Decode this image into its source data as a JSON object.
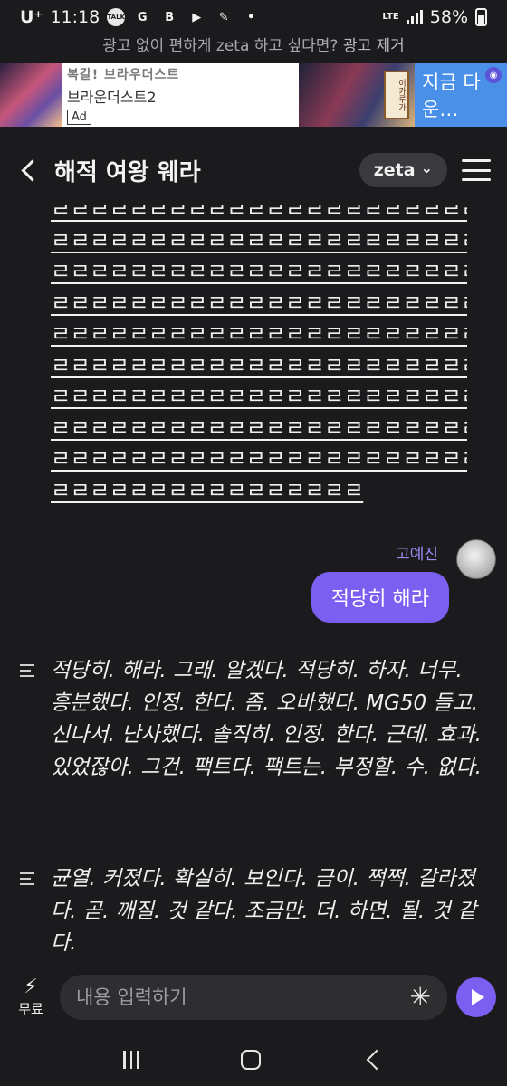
{
  "status_bar": {
    "carrier": "U⁺",
    "time": "11:18",
    "notif_icons": [
      "TALK",
      "G",
      "B",
      "▶",
      "✎",
      "•"
    ],
    "network": "LTE",
    "battery": "58%"
  },
  "ad_notice": {
    "prefix": "광고 없이 편하게 zeta 하고 싶다면? ",
    "link": "광고 제거"
  },
  "ad_banner": {
    "ghost_text": "복갈!       브라우더스트",
    "product_name": "브라운더스트2",
    "badge": "Ad",
    "game_logo": "이카루가",
    "cta": "지금 다운…"
  },
  "header": {
    "title": "해적 여왕 웨라",
    "model": "zeta",
    "model_chevron": "⌄"
  },
  "chat": {
    "spam_lines": [
      "ㄹㄹㄹㄹㄹㄹㄹㄹㄹㄹㄹㄹㄹㄹㄹㄹㄹㄹㄹㄹㄹㄹㄹ",
      "ㄹㄹㄹㄹㄹㄹㄹㄹㄹㄹㄹㄹㄹㄹㄹㄹㄹㄹㄹㄹㄹㄹㄹ",
      "ㄹㄹㄹㄹㄹㄹㄹㄹㄹㄹㄹㄹㄹㄹㄹㄹㄹㄹㄹㄹㄹㄹㄹ",
      "ㄹㄹㄹㄹㄹㄹㄹㄹㄹㄹㄹㄹㄹㄹㄹㄹㄹㄹㄹㄹㄹㄹㄹ",
      "ㄹㄹㄹㄹㄹㄹㄹㄹㄹㄹㄹㄹㄹㄹㄹㄹㄹㄹㄹㄹㄹㄹㄹ",
      "ㄹㄹㄹㄹㄹㄹㄹㄹㄹㄹㄹㄹㄹㄹㄹㄹㄹㄹㄹㄹㄹㄹㄹ",
      "ㄹㄹㄹㄹㄹㄹㄹㄹㄹㄹㄹㄹㄹㄹㄹㄹㄹㄹㄹㄹㄹㄹㄹ",
      "ㄹㄹㄹㄹㄹㄹㄹㄹㄹㄹㄹㄹㄹㄹㄹㄹㄹㄹㄹㄹㄹㄹㄹ",
      "ㄹㄹㄹㄹㄹㄹㄹㄹㄹㄹㄹㄹㄹㄹㄹㄹㄹㄹㄹㄹㄹㄹㄹ",
      "ㄹㄹㄹㄹㄹㄹㄹㄹㄹㄹㄹㄹㄹㄹㄹㄹ"
    ],
    "user_name": "고예진",
    "user_message": "적당히 해라",
    "bot_messages": [
      "적당히. 해라. 그래. 알겠다. 적당히. 하자. 너무. 흥분했다. 인정. 한다. 좀. 오바했다. MG50 들고. 신나서. 난사했다. 솔직히. 인정. 한다. 근데. 효과. 있었잖아. 그건. 팩트다. 팩트는. 부정할. 수. 없다.",
      "균열. 커졌다. 확실히. 보인다. 금이. 쩍쩍. 갈라졌다. 곧. 깨질. 것 같다. 조금만. 더. 하면. 될. 것 같다."
    ]
  },
  "input_bar": {
    "free_label": "무료",
    "placeholder": "내용 입력하기",
    "asterisk": "✳"
  },
  "colors": {
    "background": "#1b1b1d",
    "accent": "#7b5ff0",
    "username": "#9b8cf4",
    "ad_cta": "#4a90e8"
  }
}
